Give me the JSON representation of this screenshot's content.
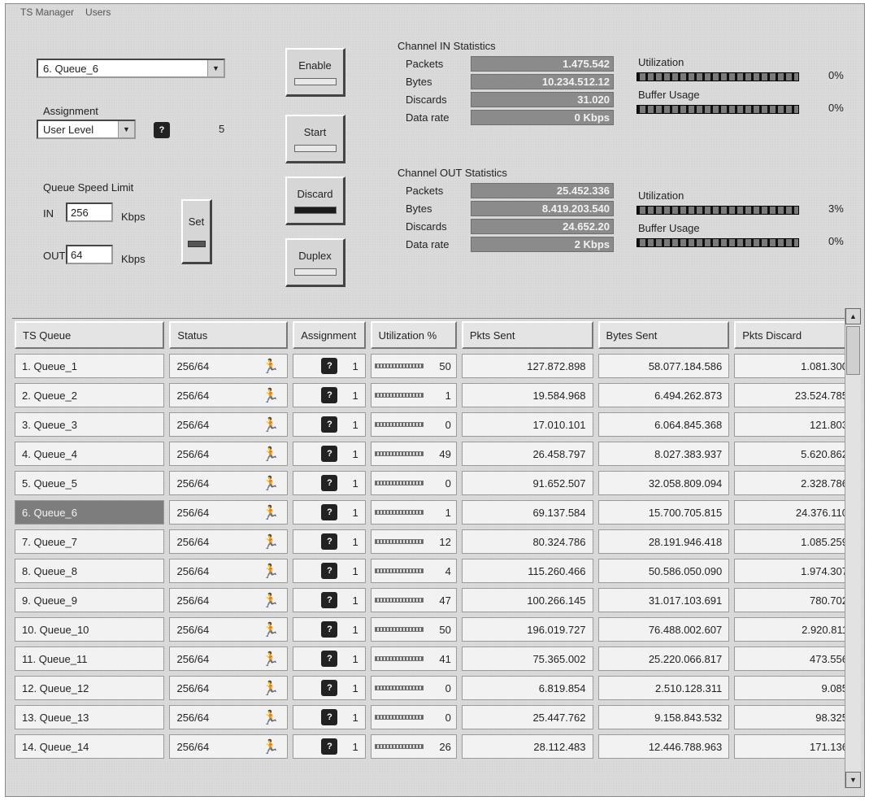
{
  "menu": [
    "TS Manager",
    "Users"
  ],
  "queue_select": "6. Queue_6",
  "assignment": {
    "label": "Assignment",
    "value": "User Level",
    "level": "5"
  },
  "speed_limit": {
    "label": "Queue Speed Limit",
    "in_label": "IN",
    "in_value": "256",
    "in_unit": "Kbps",
    "out_label": "OUT",
    "out_value": "64",
    "out_unit": "Kbps",
    "set_label": "Set"
  },
  "buttons": {
    "enable": "Enable",
    "start": "Start",
    "discard": "Discard",
    "duplex": "Duplex"
  },
  "channel_in": {
    "title": "Channel IN Statistics",
    "packets_label": "Packets",
    "packets_value": "1.475.542",
    "bytes_label": "Bytes",
    "bytes_value": "10.234.512.12",
    "discards_label": "Discards",
    "discards_value": "31.020",
    "datarate_label": "Data rate",
    "datarate_value": "0 Kbps",
    "utilization_label": "Utilization",
    "utilization_pct": "0%",
    "buffer_label": "Buffer Usage",
    "buffer_pct": "0%"
  },
  "channel_out": {
    "title": "Channel OUT Statistics",
    "packets_label": "Packets",
    "packets_value": "25.452.336",
    "bytes_label": "Bytes",
    "bytes_value": "8.419.203.540",
    "discards_label": "Discards",
    "discards_value": "24.652.20",
    "datarate_label": "Data rate",
    "datarate_value": "2 Kbps",
    "utilization_label": "Utilization",
    "utilization_pct": "3%",
    "buffer_label": "Buffer Usage",
    "buffer_pct": "0%"
  },
  "table": {
    "headers": [
      "TS Queue",
      "Status",
      "Assignment",
      "Utilization %",
      "Pkts Sent",
      "Bytes Sent",
      "Pkts Discard"
    ],
    "rows": [
      {
        "queue": "1. Queue_1",
        "status": "256/64",
        "assign": "1",
        "util": "50",
        "pkts": "127.872.898",
        "bytes": "58.077.184.586",
        "discard": "1.081.300"
      },
      {
        "queue": "2. Queue_2",
        "status": "256/64",
        "assign": "1",
        "util": "1",
        "pkts": "19.584.968",
        "bytes": "6.494.262.873",
        "discard": "23.524.785"
      },
      {
        "queue": "3. Queue_3",
        "status": "256/64",
        "assign": "1",
        "util": "0",
        "pkts": "17.010.101",
        "bytes": "6.064.845.368",
        "discard": "121.803"
      },
      {
        "queue": "4. Queue_4",
        "status": "256/64",
        "assign": "1",
        "util": "49",
        "pkts": "26.458.797",
        "bytes": "8.027.383.937",
        "discard": "5.620.862"
      },
      {
        "queue": "5. Queue_5",
        "status": "256/64",
        "assign": "1",
        "util": "0",
        "pkts": "91.652.507",
        "bytes": "32.058.809.094",
        "discard": "2.328.786"
      },
      {
        "queue": "6. Queue_6",
        "status": "256/64",
        "assign": "1",
        "util": "1",
        "pkts": "69.137.584",
        "bytes": "15.700.705.815",
        "discard": "24.376.110"
      },
      {
        "queue": "7. Queue_7",
        "status": "256/64",
        "assign": "1",
        "util": "12",
        "pkts": "80.324.786",
        "bytes": "28.191.946.418",
        "discard": "1.085.259"
      },
      {
        "queue": "8. Queue_8",
        "status": "256/64",
        "assign": "1",
        "util": "4",
        "pkts": "115.260.466",
        "bytes": "50.586.050.090",
        "discard": "1.974.307"
      },
      {
        "queue": "9. Queue_9",
        "status": "256/64",
        "assign": "1",
        "util": "47",
        "pkts": "100.266.145",
        "bytes": "31.017.103.691",
        "discard": "780.702"
      },
      {
        "queue": "10. Queue_10",
        "status": "256/64",
        "assign": "1",
        "util": "50",
        "pkts": "196.019.727",
        "bytes": "76.488.002.607",
        "discard": "2.920.811"
      },
      {
        "queue": "11. Queue_11",
        "status": "256/64",
        "assign": "1",
        "util": "41",
        "pkts": "75.365.002",
        "bytes": "25.220.066.817",
        "discard": "473.556"
      },
      {
        "queue": "12. Queue_12",
        "status": "256/64",
        "assign": "1",
        "util": "0",
        "pkts": "6.819.854",
        "bytes": "2.510.128.311",
        "discard": "9.085"
      },
      {
        "queue": "13. Queue_13",
        "status": "256/64",
        "assign": "1",
        "util": "0",
        "pkts": "25.447.762",
        "bytes": "9.158.843.532",
        "discard": "98.325"
      },
      {
        "queue": "14. Queue_14",
        "status": "256/64",
        "assign": "1",
        "util": "26",
        "pkts": "28.112.483",
        "bytes": "12.446.788.963",
        "discard": "171.136"
      }
    ],
    "selected_index": 5
  },
  "icons": {
    "status_icon": "runner-icon",
    "assign_icon": "user-level-icon"
  }
}
